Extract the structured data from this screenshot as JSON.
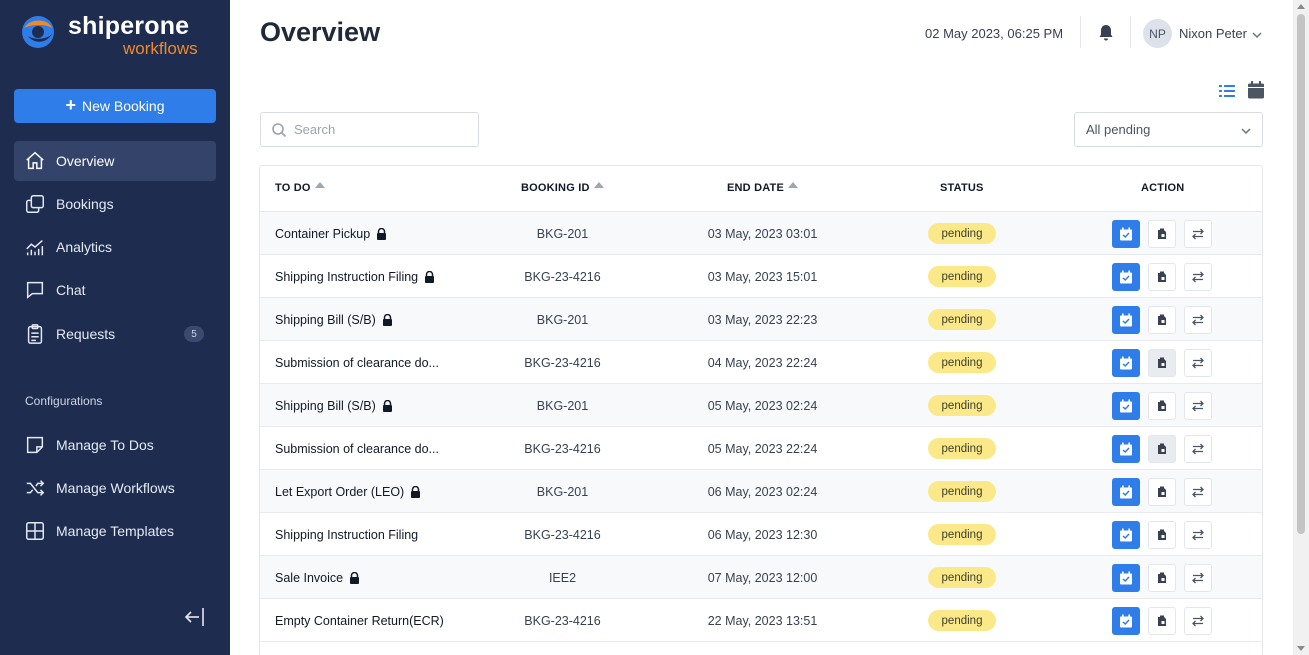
{
  "brand": {
    "name": "shiperone",
    "sub": "workflows"
  },
  "sidebar": {
    "new_booking_label": "New Booking",
    "items": [
      {
        "label": "Overview",
        "icon": "home-icon",
        "active": true
      },
      {
        "label": "Bookings",
        "icon": "copy-icon"
      },
      {
        "label": "Analytics",
        "icon": "chart-icon"
      },
      {
        "label": "Chat",
        "icon": "chat-icon"
      },
      {
        "label": "Requests",
        "icon": "clipboard-icon",
        "count": "5"
      }
    ],
    "config_label": "Configurations",
    "config_items": [
      {
        "label": "Manage To Dos",
        "icon": "note-icon"
      },
      {
        "label": "Manage Workflows",
        "icon": "shuffle-icon"
      },
      {
        "label": "Manage Templates",
        "icon": "grid-icon"
      }
    ]
  },
  "header": {
    "title": "Overview",
    "datetime": "02 May 2023, 06:25 PM",
    "avatar_initials": "NP",
    "user_name": "Nixon Peter"
  },
  "search": {
    "placeholder": "Search",
    "value": ""
  },
  "filter": {
    "selected": "All pending"
  },
  "table": {
    "columns": {
      "todo": "TO DO",
      "booking_id": "BOOKING ID",
      "end_date": "END DATE",
      "status": "STATUS",
      "action": "ACTION"
    },
    "rows": [
      {
        "todo": "Container Pickup",
        "locked": true,
        "booking_id": "BKG-201",
        "end_date": "03 May, 2023 03:01",
        "status": "pending"
      },
      {
        "todo": "Shipping Instruction Filing",
        "locked": true,
        "booking_id": "BKG-23-4216",
        "end_date": "03 May, 2023 15:01",
        "status": "pending"
      },
      {
        "todo": "Shipping Bill (S/B)",
        "locked": true,
        "booking_id": "BKG-201",
        "end_date": "03 May, 2023 22:23",
        "status": "pending"
      },
      {
        "todo": "Submission of clearance do...",
        "locked": false,
        "booking_id": "BKG-23-4216",
        "end_date": "04 May, 2023 22:24",
        "status": "pending"
      },
      {
        "todo": "Shipping Bill (S/B)",
        "locked": true,
        "booking_id": "BKG-201",
        "end_date": "05 May, 2023 02:24",
        "status": "pending"
      },
      {
        "todo": "Submission of clearance do...",
        "locked": false,
        "booking_id": "BKG-23-4216",
        "end_date": "05 May, 2023 22:24",
        "status": "pending"
      },
      {
        "todo": "Let Export Order (LEO)",
        "locked": true,
        "booking_id": "BKG-201",
        "end_date": "06 May, 2023 02:24",
        "status": "pending"
      },
      {
        "todo": "Shipping Instruction Filing",
        "locked": false,
        "booking_id": "BKG-23-4216",
        "end_date": "06 May, 2023 12:30",
        "status": "pending"
      },
      {
        "todo": "Sale Invoice",
        "locked": true,
        "booking_id": "IEE2",
        "end_date": "07 May, 2023 12:00",
        "status": "pending"
      },
      {
        "todo": "Empty Container Return(ECR)",
        "locked": false,
        "booking_id": "BKG-23-4216",
        "end_date": "22 May, 2023 13:51",
        "status": "pending"
      }
    ]
  },
  "colors": {
    "sidebar_bg": "#1e2d4f",
    "accent": "#2f7de8",
    "brand_orange": "#f0892a",
    "pending_badge": "#fbe989"
  }
}
